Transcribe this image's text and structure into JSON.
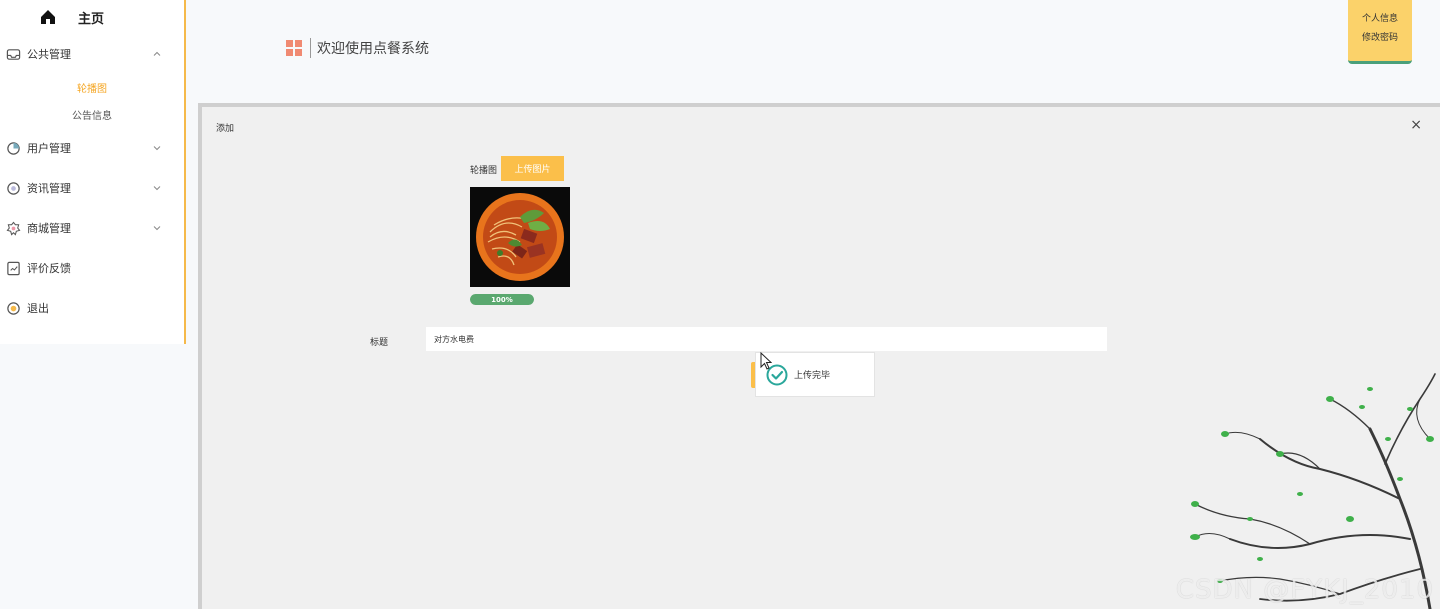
{
  "sidebar": {
    "home_label": "主页",
    "menus": [
      {
        "label": "公共管理",
        "icon": "inbox-icon",
        "expanded": true
      },
      {
        "label": "用户管理",
        "icon": "pie-chart-icon",
        "expanded": false
      },
      {
        "label": "资讯管理",
        "icon": "news-icon",
        "expanded": false
      },
      {
        "label": "商城管理",
        "icon": "shop-icon",
        "expanded": false
      },
      {
        "label": "评价反馈",
        "icon": "feedback-icon"
      },
      {
        "label": "退出",
        "icon": "exit-icon"
      }
    ],
    "submenu": [
      {
        "label": "轮播图",
        "active": true
      },
      {
        "label": "公告信息",
        "active": false
      }
    ],
    "accent_color": "#f5a623"
  },
  "header": {
    "welcome": "欢迎使用点餐系统",
    "user_menu": {
      "profile": "个人信息",
      "change_password": "修改密码"
    }
  },
  "dialog": {
    "title": "添加",
    "close_symbol": "×",
    "image_label": "轮播图",
    "upload_button": "上传图片",
    "progress": {
      "value": 100,
      "text": "100%"
    },
    "title_label": "标题",
    "title_value": "对方水电费"
  },
  "toast": {
    "message": "上传完毕"
  },
  "watermark": "CSDN @FYKJ_2010"
}
